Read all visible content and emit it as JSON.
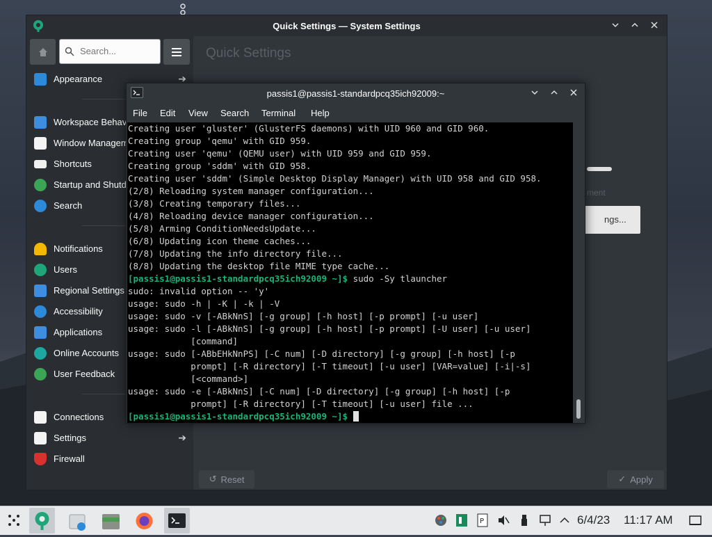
{
  "desktop": {
    "sidebar_handle": "handle-icon"
  },
  "system_settings": {
    "title": "Quick Settings — System Settings",
    "search_placeholder": "Search...",
    "main_title": "Quick Settings",
    "faded_button_text": "ngs...",
    "faded_note_text": "ment",
    "reset_label": "Reset",
    "apply_label": "Apply",
    "nav": {
      "appearance": "Appearance",
      "workspace": "Workspace Behavi",
      "window_mgmt": "Window Managem",
      "shortcuts": "Shortcuts",
      "startup": "Startup and Shutd",
      "search": "Search",
      "notifications": "Notifications",
      "users": "Users",
      "regional": "Regional Settings",
      "accessibility": "Accessibility",
      "applications": "Applications",
      "online_accounts": "Online Accounts",
      "user_feedback": "User Feedback",
      "connections": "Connections",
      "settings": "Settings",
      "firewall": "Firewall"
    }
  },
  "terminal": {
    "title": "passis1@passis1-standardpcq35ich92009:~",
    "menu": {
      "file": "File",
      "edit": "Edit",
      "view": "View",
      "search": "Search",
      "terminal": "Terminal",
      "help": "Help"
    },
    "lines": {
      "l1": "Creating user 'gluster' (GlusterFS daemons) with UID 960 and GID 960.",
      "l2": "Creating group 'qemu' with GID 959.",
      "l3": "Creating user 'qemu' (QEMU user) with UID 959 and GID 959.",
      "l4": "Creating group 'sddm' with GID 958.",
      "l5": "Creating user 'sddm' (Simple Desktop Display Manager) with UID 958 and GID 958.",
      "l6": "(2/8) Reloading system manager configuration...",
      "l7": "(3/8) Creating temporary files...",
      "l8": "(4/8) Reloading device manager configuration...",
      "l9": "(5/8) Arming ConditionNeedsUpdate...",
      "l10": "(6/8) Updating icon theme caches...",
      "l11": "(7/8) Updating the info directory file...",
      "l12": "(8/8) Updating the desktop file MIME type cache...",
      "p1_prompt": "[passis1@passis1-standardpcq35ich92009 ~]$",
      "p1_cmd": " sudo -Sy tlauncher",
      "l14": "sudo: invalid option -- 'y'",
      "l15": "usage: sudo -h | -K | -k | -V",
      "l16": "usage: sudo -v [-ABkNnS] [-g group] [-h host] [-p prompt] [-u user]",
      "l17": "usage: sudo -l [-ABkNnS] [-g group] [-h host] [-p prompt] [-U user] [-u user]",
      "l18": "            [command]",
      "l19": "usage: sudo [-ABbEHkNnPS] [-C num] [-D directory] [-g group] [-h host] [-p",
      "l20": "            prompt] [-R directory] [-T timeout] [-u user] [VAR=value] [-i|-s]",
      "l21": "            [<command>]",
      "l22": "usage: sudo -e [-ABkNnS] [-C num] [-D directory] [-g group] [-h host] [-p",
      "l23": "            prompt] [-R directory] [-T timeout] [-u user] file ...",
      "p2_prompt": "[passis1@passis1-standardpcq35ich92009 ~]$",
      "p2_cmd": " "
    }
  },
  "taskbar": {
    "date": "6/4/23",
    "time": "11:17 AM"
  }
}
